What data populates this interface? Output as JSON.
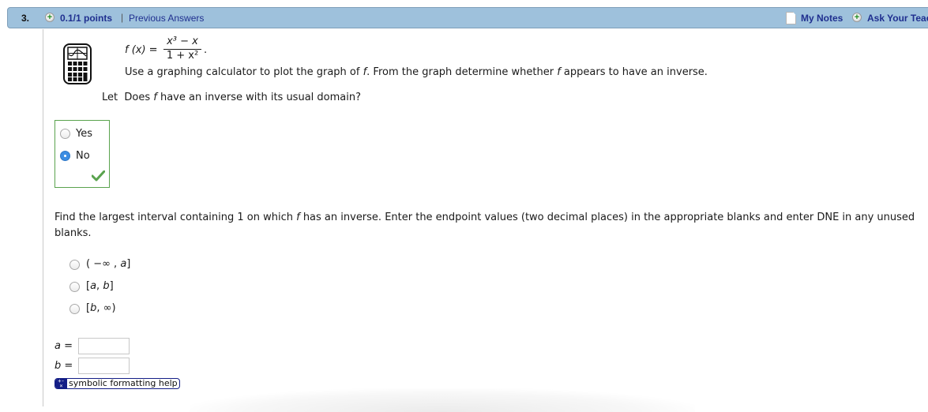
{
  "header": {
    "question_number": "3.",
    "points": "0.1/1 points",
    "separator": "|",
    "previous_answers": "Previous Answers",
    "my_notes": "My Notes",
    "ask_teacher": "Ask Your Teacher",
    "plus_glyph": "+"
  },
  "problem": {
    "calculator_icon": "graphing-calculator-icon",
    "function_lhs": "f (x) =",
    "numerator": "x³ − x",
    "denominator": "1 + x²",
    "period": ".",
    "instruction_pre": "Use a graphing calculator to plot the graph of ",
    "instruction_f": "f",
    "instruction_mid": ". From the graph determine whether ",
    "instruction_f2": "f",
    "instruction_post": " appears to have an inverse.",
    "question1_pre": "Let  Does ",
    "question1_f": "f",
    "question1_post": " have an inverse with its usual domain?"
  },
  "part1": {
    "options": [
      {
        "label": "Yes",
        "selected": false
      },
      {
        "label": "No",
        "selected": true
      }
    ],
    "status": "correct",
    "accent_color": "#5aa34e"
  },
  "part2": {
    "question_pre": "Find the largest interval containing 1 on which ",
    "question_f": "f",
    "question_post": " has an inverse. Enter the endpoint values (two decimal places) in the appropriate blanks and enter DNE in any unused blanks.",
    "intervals": [
      {
        "open": "( −∞ , ",
        "var": "a",
        "close": "]",
        "selected": false
      },
      {
        "open": "[",
        "var": "a",
        "mid": ", ",
        "var2": "b",
        "close": "]",
        "selected": false
      },
      {
        "open": "[",
        "var": "b",
        "close": ", ∞)",
        "selected": false
      }
    ],
    "inputs": [
      {
        "var": "a",
        "eq": " =",
        "value": ""
      },
      {
        "var": "b",
        "eq": " =",
        "value": ""
      }
    ],
    "help_icon_text": "+-\n×",
    "help_label": "symbolic formatting help"
  },
  "colors": {
    "header_bg": "#9ec1dc",
    "link": "#1f2f8f",
    "radio_checked": "#3b8de3",
    "correct": "#5aa34e"
  }
}
